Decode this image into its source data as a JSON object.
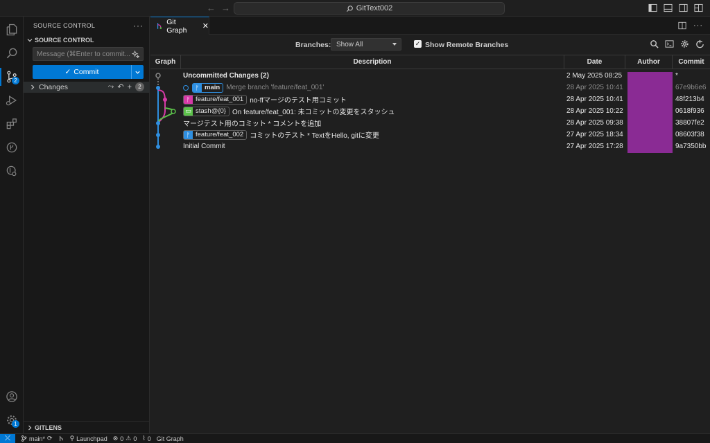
{
  "title": {
    "command_center": "GitText002"
  },
  "activity": {
    "scm_badge": "2",
    "accounts_badge": "1"
  },
  "sidebar": {
    "header": "SOURCE CONTROL",
    "section": "SOURCE CONTROL",
    "message_placeholder": "Message (⌘Enter to commit...",
    "commit_label": "Commit",
    "changes_label": "Changes",
    "changes_count": "2",
    "gitlens_label": "GITLENS"
  },
  "tab": {
    "label": "Git Graph"
  },
  "controls": {
    "branches_label": "Branches:",
    "branches_value": "Show All",
    "remote_label": "Show Remote Branches",
    "remote_checked": true
  },
  "table": {
    "headers": {
      "graph": "Graph",
      "description": "Description",
      "date": "Date",
      "author": "Author",
      "commit": "Commit"
    },
    "rows": [
      {
        "desc": "Uncommitted Changes (2)",
        "date": "2 May 2025 08:25",
        "commit": "*"
      },
      {
        "ref": "main",
        "desc": "Merge branch 'feature/feat_001'",
        "date": "28 Apr 2025 10:41",
        "commit": "67e9b6e6"
      },
      {
        "ref": "feature/feat_001",
        "desc": "no-ffマージのテスト用コミット",
        "date": "28 Apr 2025 10:41",
        "commit": "48f213b4"
      },
      {
        "ref": "stash@{0}",
        "desc": "On feature/feat_001: 未コミットの変更をスタッシュ",
        "date": "28 Apr 2025 10:22",
        "commit": "0618f936"
      },
      {
        "desc": "マージテスト用のコミット * コメントを追加",
        "date": "28 Apr 2025 09:38",
        "commit": "38807fe2"
      },
      {
        "ref": "feature/feat_002",
        "desc": "コミットのテスト * TextをHello, gitに変更",
        "date": "27 Apr 2025 18:34",
        "commit": "08603f38"
      },
      {
        "desc": "Initial Commit",
        "date": "27 Apr 2025 17:28",
        "commit": "9a7350bb"
      }
    ]
  },
  "colors": {
    "accent": "#0078d4",
    "branch_main": "#2f8fe0",
    "branch_feat_001": "#d63aa7",
    "stash": "#5cc24a",
    "author_redaction": "#8a2b94"
  },
  "statusbar": {
    "branch": "main*",
    "launchpad": "Launchpad",
    "errors": "0",
    "warnings": "0",
    "ports": "0",
    "git_graph": "Git Graph"
  }
}
